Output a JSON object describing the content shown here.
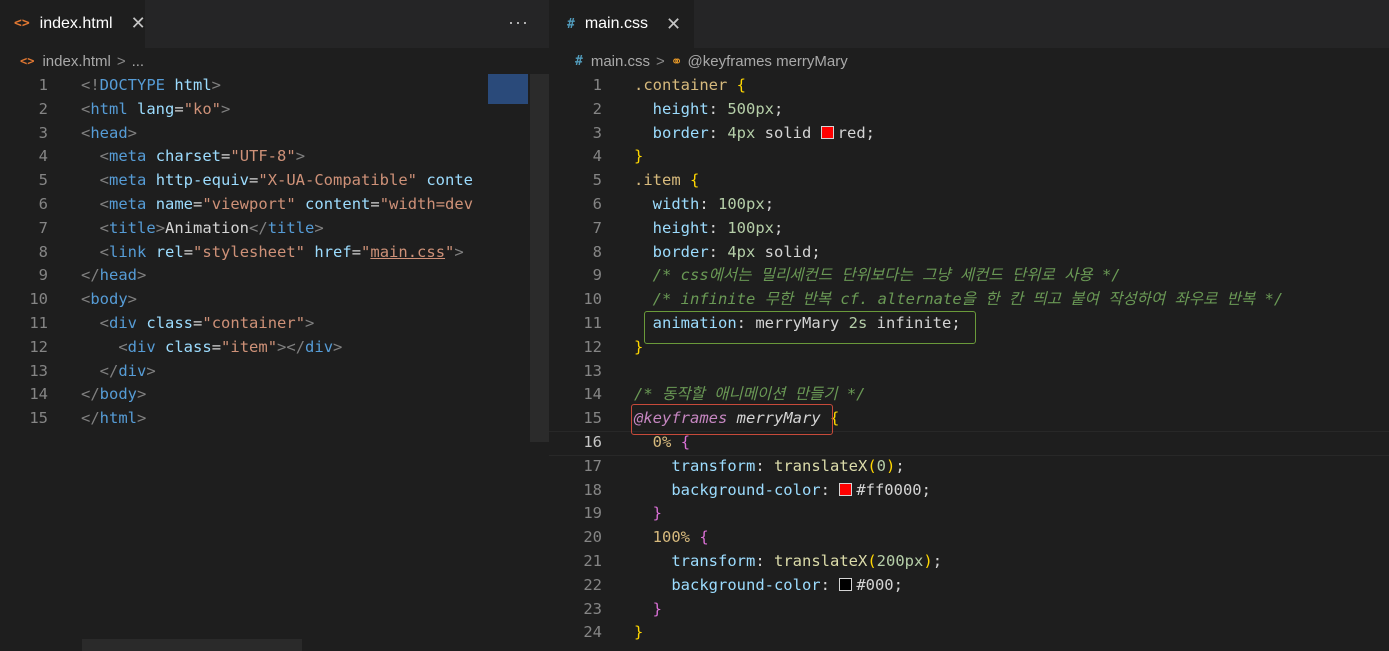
{
  "left_editor": {
    "tab": {
      "icon": "<>",
      "label": "index.html",
      "close": "✕"
    },
    "more": "···",
    "breadcrumb": {
      "icon": "<>",
      "file": "index.html",
      "sep": ">",
      "rest": "..."
    },
    "lines": [
      {
        "n": "1",
        "html": "<span class='t-brk'>&lt;!</span><span class='t-tag'>DOCTYPE</span> <span class='t-attr'>html</span><span class='t-brk'>&gt;</span>"
      },
      {
        "n": "2",
        "html": "<span class='t-brk'>&lt;</span><span class='t-tag'>html</span> <span class='t-attr'>lang</span><span class='t-text'>=</span><span class='t-str'>\"ko\"</span><span class='t-brk'>&gt;</span>"
      },
      {
        "n": "3",
        "html": "<span class='t-brk'>&lt;</span><span class='t-tag'>head</span><span class='t-brk'>&gt;</span>"
      },
      {
        "n": "4",
        "html": "  <span class='t-brk'>&lt;</span><span class='t-tag'>meta</span> <span class='t-attr'>charset</span><span class='t-text'>=</span><span class='t-str'>\"UTF-8\"</span><span class='t-brk'>&gt;</span>"
      },
      {
        "n": "5",
        "html": "  <span class='t-brk'>&lt;</span><span class='t-tag'>meta</span> <span class='t-attr'>http-equiv</span><span class='t-text'>=</span><span class='t-str'>\"X-UA-Compatible\"</span> <span class='t-attr'>conte</span>"
      },
      {
        "n": "6",
        "html": "  <span class='t-brk'>&lt;</span><span class='t-tag'>meta</span> <span class='t-attr'>name</span><span class='t-text'>=</span><span class='t-str'>\"viewport\"</span> <span class='t-attr'>content</span><span class='t-text'>=</span><span class='t-str'>\"width=dev</span>"
      },
      {
        "n": "7",
        "html": "  <span class='t-brk'>&lt;</span><span class='t-tag'>title</span><span class='t-brk'>&gt;</span><span class='t-text'>Animation</span><span class='t-brk'>&lt;/</span><span class='t-tag'>title</span><span class='t-brk'>&gt;</span>"
      },
      {
        "n": "8",
        "html": "  <span class='t-brk'>&lt;</span><span class='t-tag'>link</span> <span class='t-attr'>rel</span><span class='t-text'>=</span><span class='t-str'>\"stylesheet\"</span> <span class='t-attr'>href</span><span class='t-text'>=</span><span class='t-str'>\"<u>main.css</u>\"</span><span class='t-brk'>&gt;</span>"
      },
      {
        "n": "9",
        "html": "<span class='t-brk'>&lt;/</span><span class='t-tag'>head</span><span class='t-brk'>&gt;</span>"
      },
      {
        "n": "10",
        "html": "<span class='t-brk'>&lt;</span><span class='t-tag'>body</span><span class='t-brk'>&gt;</span>"
      },
      {
        "n": "11",
        "html": "  <span class='t-brk'>&lt;</span><span class='t-tag'>div</span> <span class='t-attr'>class</span><span class='t-text'>=</span><span class='t-str'>\"container\"</span><span class='t-brk'>&gt;</span>"
      },
      {
        "n": "12",
        "html": "    <span class='t-brk'>&lt;</span><span class='t-tag'>div</span> <span class='t-attr'>class</span><span class='t-text'>=</span><span class='t-str'>\"item\"</span><span class='t-brk'>&gt;&lt;/</span><span class='t-tag'>div</span><span class='t-brk'>&gt;</span>"
      },
      {
        "n": "13",
        "html": "  <span class='t-brk'>&lt;/</span><span class='t-tag'>div</span><span class='t-brk'>&gt;</span>"
      },
      {
        "n": "14",
        "html": "<span class='t-brk'>&lt;/</span><span class='t-tag'>body</span><span class='t-brk'>&gt;</span>"
      },
      {
        "n": "15",
        "html": "<span class='t-brk'>&lt;/</span><span class='t-tag'>html</span><span class='t-brk'>&gt;</span>"
      }
    ]
  },
  "right_editor": {
    "tab": {
      "icon": "#",
      "label": "main.css",
      "close": "✕"
    },
    "breadcrumb": {
      "icon": "#",
      "file": "main.css",
      "sep": ">",
      "symbol": "@keyframes merryMary"
    },
    "current_line": "16",
    "colors": {
      "red": "#ff0000",
      "black": "#000000"
    },
    "lines": [
      {
        "n": "1",
        "html": "<span class='t-sel'>.container</span> <span class='t-b1'>{</span>"
      },
      {
        "n": "2",
        "html": "  <span class='t-prop'>height</span><span class='t-val'>: </span><span class='t-num'>500px</span><span class='t-val'>;</span>"
      },
      {
        "n": "3",
        "html": "  <span class='t-prop'>border</span><span class='t-val'>: </span><span class='t-num'>4px</span><span class='t-val'> solid </span><span class='swatch' style='background:#ff0000'></span><span class='t-val'>red;</span>"
      },
      {
        "n": "4",
        "html": "<span class='t-b1'>}</span>"
      },
      {
        "n": "5",
        "html": "<span class='t-sel'>.item</span> <span class='t-b1'>{</span>"
      },
      {
        "n": "6",
        "html": "  <span class='t-prop'>width</span><span class='t-val'>: </span><span class='t-num'>100px</span><span class='t-val'>;</span>"
      },
      {
        "n": "7",
        "html": "  <span class='t-prop'>height</span><span class='t-val'>: </span><span class='t-num'>100px</span><span class='t-val'>;</span>"
      },
      {
        "n": "8",
        "html": "  <span class='t-prop'>border</span><span class='t-val'>: </span><span class='t-num'>4px</span><span class='t-val'> solid;</span>"
      },
      {
        "n": "9",
        "html": "  <span class='t-com'>/* css에서는 밀리세컨드 단위보다는 그냥 세컨드 단위로 사용 */</span>"
      },
      {
        "n": "10",
        "html": "  <span class='t-com'>/* infinite 무한 반복 cf. alternate을 한 칸 띄고 붙여 작성하여 좌우로 반복 */</span>"
      },
      {
        "n": "11",
        "html": "  <span class='t-prop'>animation</span><span class='t-val'>: merryMary </span><span class='t-num'>2s</span><span class='t-val'> infinite;</span>"
      },
      {
        "n": "12",
        "html": "<span class='t-b1'>}</span>"
      },
      {
        "n": "13",
        "html": ""
      },
      {
        "n": "14",
        "html": "<span class='t-com'>/* 동작할 애니메이션 만들기 */</span>"
      },
      {
        "n": "15",
        "html": "<span class='t-at'>@keyframes</span><span class='t-val' style='font-style:italic'> merryMary</span> <span class='t-b1'>{</span>"
      },
      {
        "n": "16",
        "html": "  <span class='t-pct' style='color:#d7ba7d'>0%</span> <span class='t-b2'>{</span>"
      },
      {
        "n": "17",
        "html": "    <span class='t-prop'>transform</span><span class='t-val'>: </span><span class='t-fn'>translateX</span><span class='t-b1'>(</span><span class='t-num'>0</span><span class='t-b1'>)</span><span class='t-val'>;</span>"
      },
      {
        "n": "18",
        "html": "    <span class='t-prop'>background-color</span><span class='t-val'>: </span><span class='swatch' style='background:#ff0000'></span><span class='t-val'>#ff0000;</span>"
      },
      {
        "n": "19",
        "html": "  <span class='t-b2'>}</span>"
      },
      {
        "n": "20",
        "html": "  <span class='t-pct' style='color:#d7ba7d'>100%</span> <span class='t-b2'>{</span>"
      },
      {
        "n": "21",
        "html": "    <span class='t-prop'>transform</span><span class='t-val'>: </span><span class='t-fn'>translateX</span><span class='t-b1'>(</span><span class='t-num'>200px</span><span class='t-b1'>)</span><span class='t-val'>;</span>"
      },
      {
        "n": "22",
        "html": "    <span class='t-prop'>background-color</span><span class='t-val'>: </span><span class='swatch' style='background:#000000'></span><span class='t-val'>#000;</span>"
      },
      {
        "n": "23",
        "html": "  <span class='t-b2'>}</span>"
      },
      {
        "n": "24",
        "html": "<span class='t-b1'>}</span>"
      }
    ]
  }
}
